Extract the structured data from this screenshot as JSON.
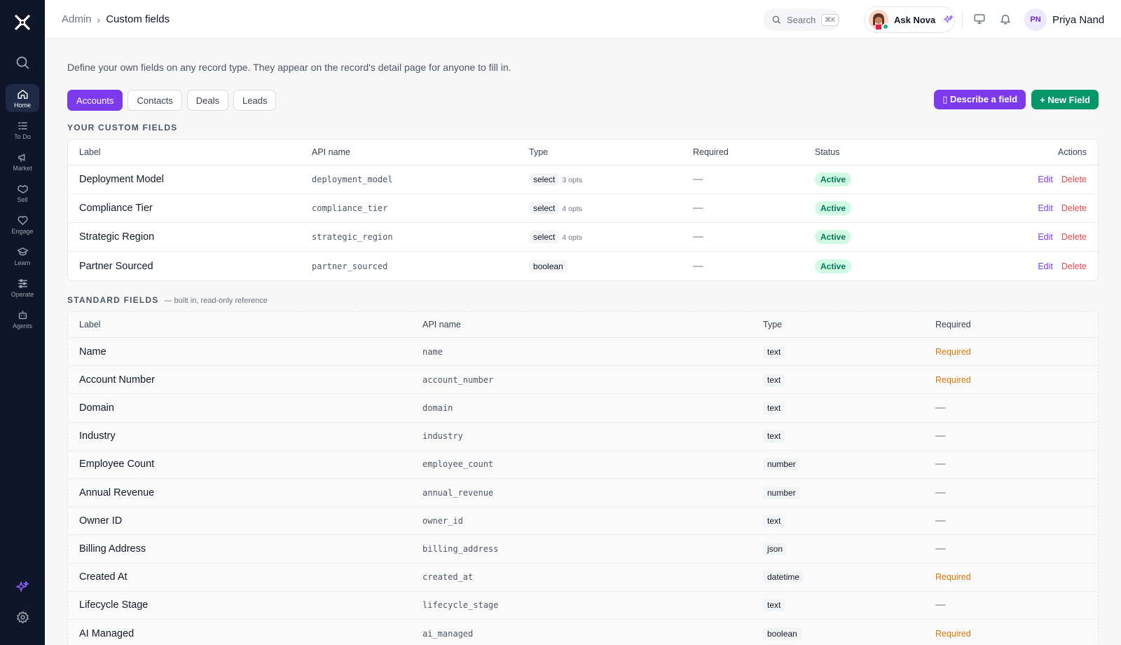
{
  "breadcrumb": {
    "parent": "Admin",
    "separator": "›",
    "current": "Custom fields"
  },
  "topbar": {
    "search_label": "Search",
    "search_shortcut": "⌘K",
    "assistant_label": "Ask Nova",
    "user_initials": "PN",
    "user_name": "Priya Nand"
  },
  "sidebar": {
    "items": [
      {
        "label": "Home",
        "icon": "home-icon"
      },
      {
        "label": "To Do",
        "icon": "checklist-icon"
      },
      {
        "label": "Market",
        "icon": "megaphone-icon"
      },
      {
        "label": "Sell",
        "icon": "handshake-icon"
      },
      {
        "label": "Engage",
        "icon": "heart-chat-icon"
      },
      {
        "label": "Learn",
        "icon": "graduation-cap-icon"
      },
      {
        "label": "Operate",
        "icon": "sliders-icon"
      },
      {
        "label": "Agents",
        "icon": "robot-icon"
      }
    ]
  },
  "page": {
    "description": "Define your own fields on any record type. They appear on the record's detail page for anyone to fill in.",
    "tabs": [
      "Accounts",
      "Contacts",
      "Deals",
      "Leads"
    ],
    "active_tab": "Accounts",
    "describe_button": "▯ Describe a field",
    "new_field_button": "+ New Field"
  },
  "custom_fields": {
    "title": "YOUR CUSTOM FIELDS",
    "headers": [
      "Label",
      "API name",
      "Type",
      "Required",
      "Status",
      "Actions"
    ],
    "rows": [
      {
        "label": "Deployment Model",
        "api": "deployment_model",
        "type": "select",
        "opts": "3 opts",
        "required": "—",
        "status": "Active",
        "edit": "Edit",
        "delete": "Delete"
      },
      {
        "label": "Compliance Tier",
        "api": "compliance_tier",
        "type": "select",
        "opts": "4 opts",
        "required": "—",
        "status": "Active",
        "edit": "Edit",
        "delete": "Delete"
      },
      {
        "label": "Strategic Region",
        "api": "strategic_region",
        "type": "select",
        "opts": "4 opts",
        "required": "—",
        "status": "Active",
        "edit": "Edit",
        "delete": "Delete"
      },
      {
        "label": "Partner Sourced",
        "api": "partner_sourced",
        "type": "boolean",
        "opts": "",
        "required": "—",
        "status": "Active",
        "edit": "Edit",
        "delete": "Delete"
      }
    ]
  },
  "standard_fields": {
    "title": "STANDARD FIELDS",
    "subtitle": "— built in, read-only reference",
    "headers": [
      "Label",
      "API name",
      "Type",
      "Required"
    ],
    "rows": [
      {
        "label": "Name",
        "api": "name",
        "type": "text",
        "required": "Required"
      },
      {
        "label": "Account Number",
        "api": "account_number",
        "type": "text",
        "required": "Required"
      },
      {
        "label": "Domain",
        "api": "domain",
        "type": "text",
        "required": "—"
      },
      {
        "label": "Industry",
        "api": "industry",
        "type": "text",
        "required": "—"
      },
      {
        "label": "Employee Count",
        "api": "employee_count",
        "type": "number",
        "required": "—"
      },
      {
        "label": "Annual Revenue",
        "api": "annual_revenue",
        "type": "number",
        "required": "—"
      },
      {
        "label": "Owner ID",
        "api": "owner_id",
        "type": "text",
        "required": "—"
      },
      {
        "label": "Billing Address",
        "api": "billing_address",
        "type": "json",
        "required": "—"
      },
      {
        "label": "Created At",
        "api": "created_at",
        "type": "datetime",
        "required": "Required"
      },
      {
        "label": "Lifecycle Stage",
        "api": "lifecycle_stage",
        "type": "text",
        "required": "—"
      },
      {
        "label": "AI Managed",
        "api": "ai_managed",
        "type": "boolean",
        "required": "Required"
      }
    ]
  },
  "colors": {
    "sidebar_bg": "#0f1629",
    "accent_purple": "#7c3aed",
    "accent_green": "#059669",
    "status_active_bg": "#d1fae5",
    "required_orange": "#d97706",
    "delete_red": "#e5484d"
  }
}
